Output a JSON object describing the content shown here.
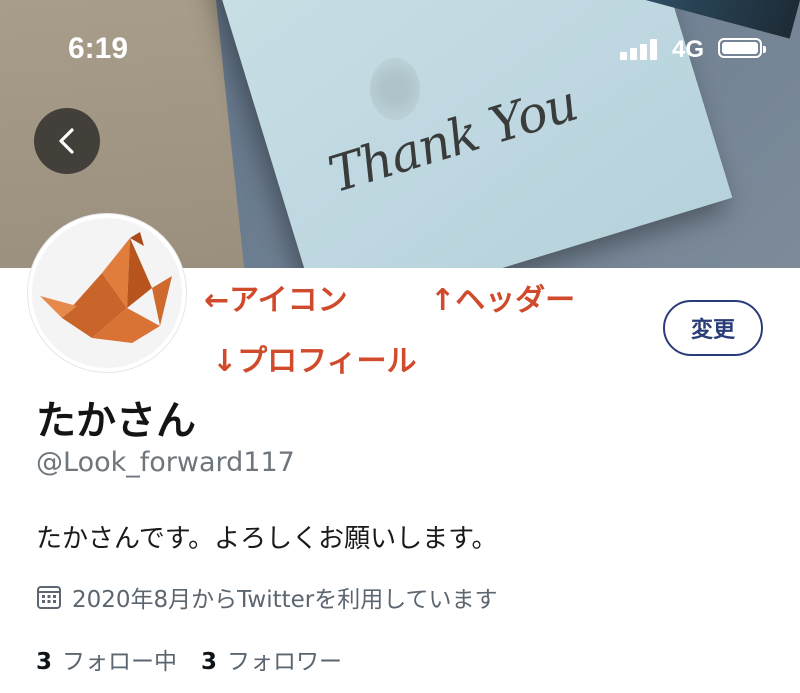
{
  "status_bar": {
    "time": "6:19",
    "network": "4G"
  },
  "annotations": {
    "icon": "←アイコン",
    "header": "↑ヘッダー",
    "profile": "↓プロフィール"
  },
  "header_card_text": "Thank You",
  "profile": {
    "name": "たかさん",
    "handle": "@Look_forward117",
    "bio": "たかさんです。よろしくお願いします。",
    "joined": "2020年8月からTwitterを利用しています",
    "following_count": "3",
    "following_label": "フォロー中",
    "followers_count": "3",
    "followers_label": "フォロワー"
  },
  "buttons": {
    "edit": "変更"
  },
  "icons": [
    "back-arrow-icon",
    "calendar-icon",
    "signal-icon",
    "battery-icon"
  ],
  "colors": {
    "annotation": "#d04a2c",
    "edit_border": "#2a3d78",
    "muted": "#5b6670"
  }
}
